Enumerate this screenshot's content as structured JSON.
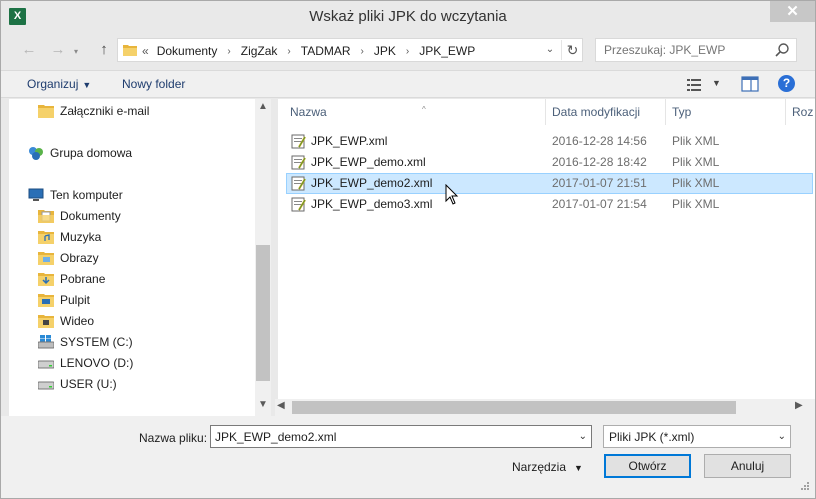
{
  "window": {
    "title": "Wskaż pliki JPK do wczytania",
    "app_icon_letter": "X",
    "close_glyph": "✕"
  },
  "nav": {
    "back_glyph": "←",
    "forward_glyph": "→",
    "up_glyph": "↑",
    "overflow": "«",
    "breadcrumbs": [
      "Dokumenty",
      "ZigZak",
      "TADMAR",
      "JPK",
      "JPK_EWP"
    ],
    "breadcrumb_separator": "›",
    "refresh_glyph": "↻",
    "dropdown_glyph": "⌄",
    "search_placeholder": "Przeszukaj: JPK_EWP"
  },
  "toolbar": {
    "organize_label": "Organizuj",
    "organize_caret": "▼",
    "new_folder_label": "Nowy folder",
    "view_caret": "▼",
    "help_glyph": "?"
  },
  "sidebar": {
    "items": [
      {
        "label": "Załączniki e-mail",
        "icon": "folder-icon"
      },
      {
        "label": "Grupa domowa",
        "icon": "homegroup-icon"
      },
      {
        "label": "Ten komputer",
        "icon": "computer-icon"
      },
      {
        "label": "Dokumenty",
        "icon": "documents-folder-icon"
      },
      {
        "label": "Muzyka",
        "icon": "music-folder-icon"
      },
      {
        "label": "Obrazy",
        "icon": "pictures-folder-icon"
      },
      {
        "label": "Pobrane",
        "icon": "downloads-folder-icon"
      },
      {
        "label": "Pulpit",
        "icon": "desktop-folder-icon"
      },
      {
        "label": "Wideo",
        "icon": "videos-folder-icon"
      },
      {
        "label": "SYSTEM (C:)",
        "icon": "system-drive-icon"
      },
      {
        "label": "LENOVO (D:)",
        "icon": "drive-icon"
      },
      {
        "label": "USER (U:)",
        "icon": "drive-icon"
      }
    ],
    "scroll_up": "▲",
    "scroll_down": "▼"
  },
  "filelist": {
    "columns": {
      "name": "Nazwa",
      "date": "Data modyfikacji",
      "type": "Typ",
      "size": "Roz"
    },
    "sort_glyph": "^",
    "rows": [
      {
        "name": "JPK_EWP.xml",
        "date": "2016-12-28 14:56",
        "type": "Plik XML",
        "selected": false
      },
      {
        "name": "JPK_EWP_demo.xml",
        "date": "2016-12-28 18:42",
        "type": "Plik XML",
        "selected": false
      },
      {
        "name": "JPK_EWP_demo2.xml",
        "date": "2017-01-07 21:51",
        "type": "Plik XML",
        "selected": true
      },
      {
        "name": "JPK_EWP_demo3.xml",
        "date": "2017-01-07 21:54",
        "type": "Plik XML",
        "selected": false
      }
    ],
    "scroll_left": "◀",
    "scroll_right": "▶"
  },
  "bottom": {
    "filename_label": "Nazwa pliku:",
    "filename_value": "JPK_EWP_demo2.xml",
    "filter_value": "Pliki JPK (*.xml)",
    "dropdown_glyph": "⌄",
    "tools_label": "Narzędzia",
    "tools_caret": "▼",
    "open_label": "Otwórz",
    "cancel_label": "Anuluj"
  },
  "colors": {
    "selection_bg": "#cce8ff",
    "selection_border": "#99d1ff",
    "primary_border": "#0078d7",
    "excel_green": "#1d7245"
  }
}
